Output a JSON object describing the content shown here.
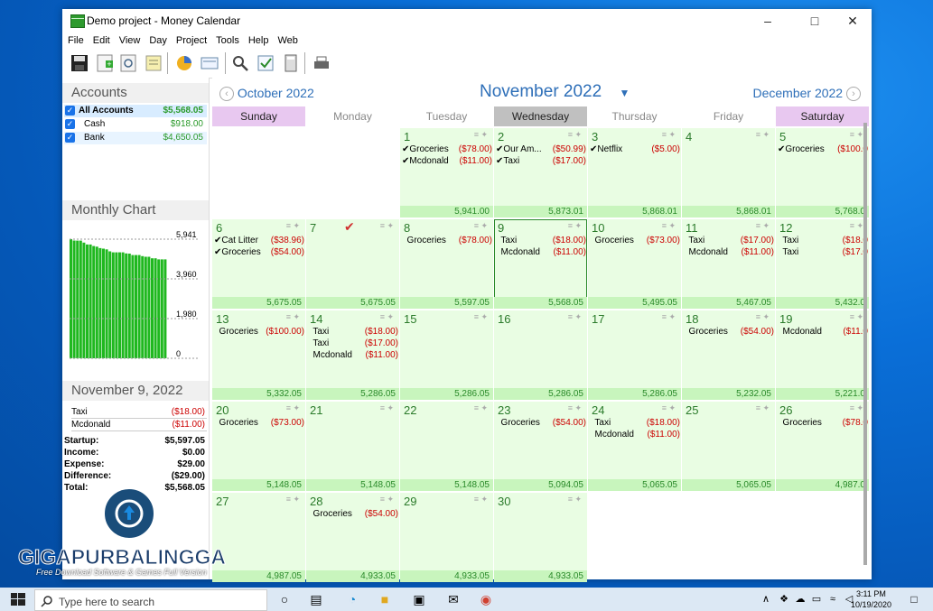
{
  "window": {
    "title": "Demo project - Money Calendar"
  },
  "menu": [
    "File",
    "Edit",
    "View",
    "Day",
    "Project",
    "Tools",
    "Help",
    "Web"
  ],
  "accounts": {
    "header": "Accounts",
    "items": [
      {
        "name": "All Accounts",
        "value": "$5,568.05"
      },
      {
        "name": "Cash",
        "value": "$918.00"
      },
      {
        "name": "Bank",
        "value": "$4,650.05"
      }
    ]
  },
  "monthly_chart": {
    "header": "Monthly Chart",
    "chart_data": {
      "type": "bar",
      "title": "",
      "y_ticks": [
        "5,941",
        "3,960",
        "1,980",
        "0"
      ],
      "ylim": [
        0,
        5941
      ],
      "values": [
        5941,
        5873.01,
        5868.01,
        5868.01,
        5768.05,
        5675.05,
        5675.05,
        5597.05,
        5568.05,
        5495.05,
        5467.05,
        5432.05,
        5332.05,
        5286.05,
        5286.05,
        5286.05,
        5286.05,
        5232.05,
        5221.05,
        5148.05,
        5148.05,
        5148.05,
        5094.05,
        5065.05,
        5065.05,
        4987.05,
        4987.05,
        4933.05,
        4933.05,
        4933.05
      ]
    }
  },
  "details": {
    "date": "November 9, 2022",
    "items": [
      {
        "name": "Taxi",
        "amount": "($18.00)"
      },
      {
        "name": "Mcdonald",
        "amount": "($11.00)"
      }
    ],
    "summary": [
      {
        "label": "Startup:",
        "value": "$5,597.05"
      },
      {
        "label": "Income:",
        "value": "$0.00"
      },
      {
        "label": "Expense:",
        "value": "$29.00"
      },
      {
        "label": "Difference:",
        "value": "($29.00)"
      },
      {
        "label": "Total:",
        "value": "$5,568.05"
      }
    ]
  },
  "calendar": {
    "prev_month": "October 2022",
    "current_month": "November 2022",
    "next_month": "December 2022",
    "days": [
      "Sunday",
      "Monday",
      "Tuesday",
      "Wednesday",
      "Thursday",
      "Friday",
      "Saturday"
    ],
    "day_colors": [
      "#e8c8f0",
      "#ffffff",
      "#ffffff",
      "#c0c0c0",
      "#ffffff",
      "#ffffff",
      "#e8c8f0"
    ],
    "cells": [
      {
        "col": 2,
        "row": 0,
        "day": "1",
        "balance": "5,941.00",
        "tx": [
          {
            "n": "✔Groceries",
            "a": "($78.00)"
          },
          {
            "n": "✔Mcdonald",
            "a": "($11.00)"
          }
        ]
      },
      {
        "col": 3,
        "row": 0,
        "day": "2",
        "balance": "5,873.01",
        "tx": [
          {
            "n": "✔Our Am...",
            "a": "($50.99)"
          },
          {
            "n": "✔Taxi",
            "a": "($17.00)"
          }
        ]
      },
      {
        "col": 4,
        "row": 0,
        "day": "3",
        "balance": "5,868.01",
        "tx": [
          {
            "n": "✔Netflix",
            "a": "($5.00)"
          }
        ]
      },
      {
        "col": 5,
        "row": 0,
        "day": "4",
        "balance": "5,868.01",
        "tx": []
      },
      {
        "col": 6,
        "row": 0,
        "day": "5",
        "balance": "5,768.0",
        "tx": [
          {
            "n": "✔Groceries",
            "a": "($100.0"
          }
        ]
      },
      {
        "col": 0,
        "row": 1,
        "day": "6",
        "balance": "5,675.05",
        "tx": [
          {
            "n": "✔Cat Litter",
            "a": "($38.96)"
          },
          {
            "n": "✔Groceries",
            "a": "($54.00)"
          }
        ]
      },
      {
        "col": 1,
        "row": 1,
        "day": "7",
        "balance": "5,675.05",
        "tx": [],
        "mark": "✔"
      },
      {
        "col": 2,
        "row": 1,
        "day": "8",
        "balance": "5,597.05",
        "tx": [
          {
            "n": "  Groceries",
            "a": "($78.00)"
          }
        ]
      },
      {
        "col": 3,
        "row": 1,
        "day": "9",
        "balance": "5,568.05",
        "selected": true,
        "tx": [
          {
            "n": "  Taxi",
            "a": "($18.00)"
          },
          {
            "n": "  Mcdonald",
            "a": "($11.00)"
          }
        ]
      },
      {
        "col": 4,
        "row": 1,
        "day": "10",
        "balance": "5,495.05",
        "tx": [
          {
            "n": "  Groceries",
            "a": "($73.00)"
          }
        ]
      },
      {
        "col": 5,
        "row": 1,
        "day": "11",
        "balance": "5,467.05",
        "tx": [
          {
            "n": "  Taxi",
            "a": "($17.00)"
          },
          {
            "n": "  Mcdonald",
            "a": "($11.00)"
          }
        ]
      },
      {
        "col": 6,
        "row": 1,
        "day": "12",
        "balance": "5,432.0",
        "tx": [
          {
            "n": "  Taxi",
            "a": "($18.0"
          },
          {
            "n": "  Taxi",
            "a": "($17.0"
          }
        ]
      },
      {
        "col": 0,
        "row": 2,
        "day": "13",
        "balance": "5,332.05",
        "tx": [
          {
            "n": "  Groceries",
            "a": "($100.00)"
          }
        ]
      },
      {
        "col": 1,
        "row": 2,
        "day": "14",
        "balance": "5,286.05",
        "tx": [
          {
            "n": "  Taxi",
            "a": "($18.00)"
          },
          {
            "n": "  Taxi",
            "a": "($17.00)"
          },
          {
            "n": "  Mcdonald",
            "a": "($11.00)"
          }
        ]
      },
      {
        "col": 2,
        "row": 2,
        "day": "15",
        "balance": "5,286.05",
        "tx": []
      },
      {
        "col": 3,
        "row": 2,
        "day": "16",
        "balance": "5,286.05",
        "tx": []
      },
      {
        "col": 4,
        "row": 2,
        "day": "17",
        "balance": "5,286.05",
        "tx": []
      },
      {
        "col": 5,
        "row": 2,
        "day": "18",
        "balance": "5,232.05",
        "tx": [
          {
            "n": "  Groceries",
            "a": "($54.00)"
          }
        ]
      },
      {
        "col": 6,
        "row": 2,
        "day": "19",
        "balance": "5,221.0",
        "tx": [
          {
            "n": "  Mcdonald",
            "a": "($11.0"
          }
        ]
      },
      {
        "col": 0,
        "row": 3,
        "day": "20",
        "balance": "5,148.05",
        "tx": [
          {
            "n": "  Groceries",
            "a": "($73.00)"
          }
        ]
      },
      {
        "col": 1,
        "row": 3,
        "day": "21",
        "balance": "5,148.05",
        "tx": []
      },
      {
        "col": 2,
        "row": 3,
        "day": "22",
        "balance": "5,148.05",
        "tx": []
      },
      {
        "col": 3,
        "row": 3,
        "day": "23",
        "balance": "5,094.05",
        "tx": [
          {
            "n": "  Groceries",
            "a": "($54.00)"
          }
        ]
      },
      {
        "col": 4,
        "row": 3,
        "day": "24",
        "balance": "5,065.05",
        "tx": [
          {
            "n": "  Taxi",
            "a": "($18.00)"
          },
          {
            "n": "  Mcdonald",
            "a": "($11.00)"
          }
        ]
      },
      {
        "col": 5,
        "row": 3,
        "day": "25",
        "balance": "5,065.05",
        "tx": []
      },
      {
        "col": 6,
        "row": 3,
        "day": "26",
        "balance": "4,987.0",
        "tx": [
          {
            "n": "  Groceries",
            "a": "($78.0"
          }
        ]
      },
      {
        "col": 0,
        "row": 4,
        "day": "27",
        "balance": "4,987.05",
        "tx": []
      },
      {
        "col": 1,
        "row": 4,
        "day": "28",
        "balance": "4,933.05",
        "tx": [
          {
            "n": "  Groceries",
            "a": "($54.00)"
          }
        ]
      },
      {
        "col": 2,
        "row": 4,
        "day": "29",
        "balance": "4,933.05",
        "tx": []
      },
      {
        "col": 3,
        "row": 4,
        "day": "30",
        "balance": "4,933.05",
        "tx": []
      }
    ]
  },
  "watermark": {
    "title": "GIGAPURBALINGGA",
    "subtitle": "Free Download Software & Games Full Version"
  },
  "taskbar": {
    "search_placeholder": "Type here to search",
    "time": "3:11 PM",
    "date": "10/19/2020"
  }
}
